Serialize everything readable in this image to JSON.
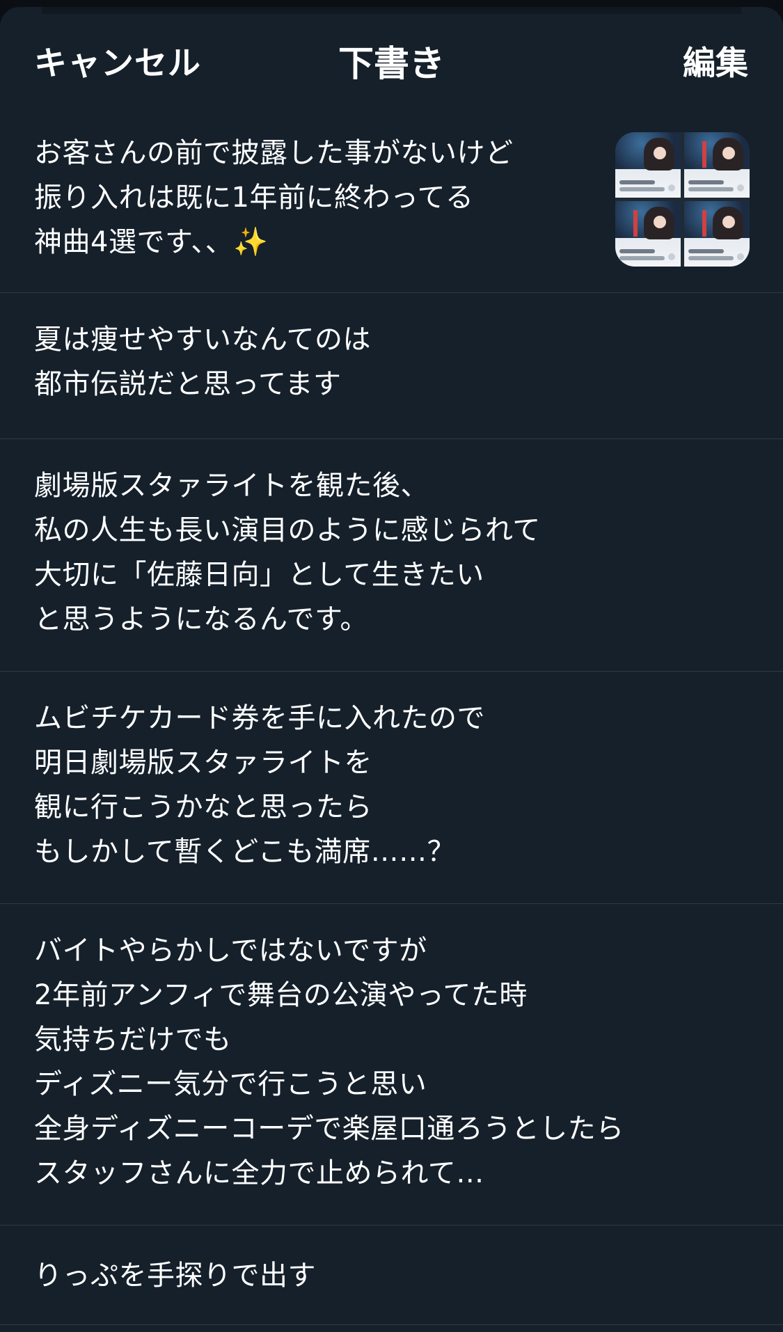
{
  "header": {
    "cancel_label": "キャンセル",
    "title": "下書き",
    "edit_label": "編集"
  },
  "drafts": [
    {
      "lines": [
        "お客さんの前で披露した事がないけど",
        "振り入れは既に1年前に終わってる",
        "神曲4選です、、✨"
      ],
      "has_media": true
    },
    {
      "lines": [
        "夏は痩せやすいなんてのは",
        "都市伝説だと思ってます"
      ]
    },
    {
      "lines": [
        "劇場版スタァライトを観た後、",
        "私の人生も長い演目のように感じられて",
        "大切に「佐藤日向」として生きたい",
        "と思うようになるんです。"
      ]
    },
    {
      "lines": [
        "ムビチケカード券を手に入れたので",
        "明日劇場版スタァライトを",
        "観に行こうかなと思ったら",
        "もしかして暫くどこも満席……？"
      ]
    },
    {
      "lines": [
        "バイトやらかしではないですが",
        "2年前アンフィで舞台の公演やってた時",
        "気持ちだけでも",
        "ディズニー気分で行こうと思い",
        "全身ディズニーコーデで楽屋口通ろうとしたら",
        "スタッフさんに全力で止められて…"
      ]
    },
    {
      "lines": [
        "りっぷを手探りで出す"
      ]
    }
  ]
}
